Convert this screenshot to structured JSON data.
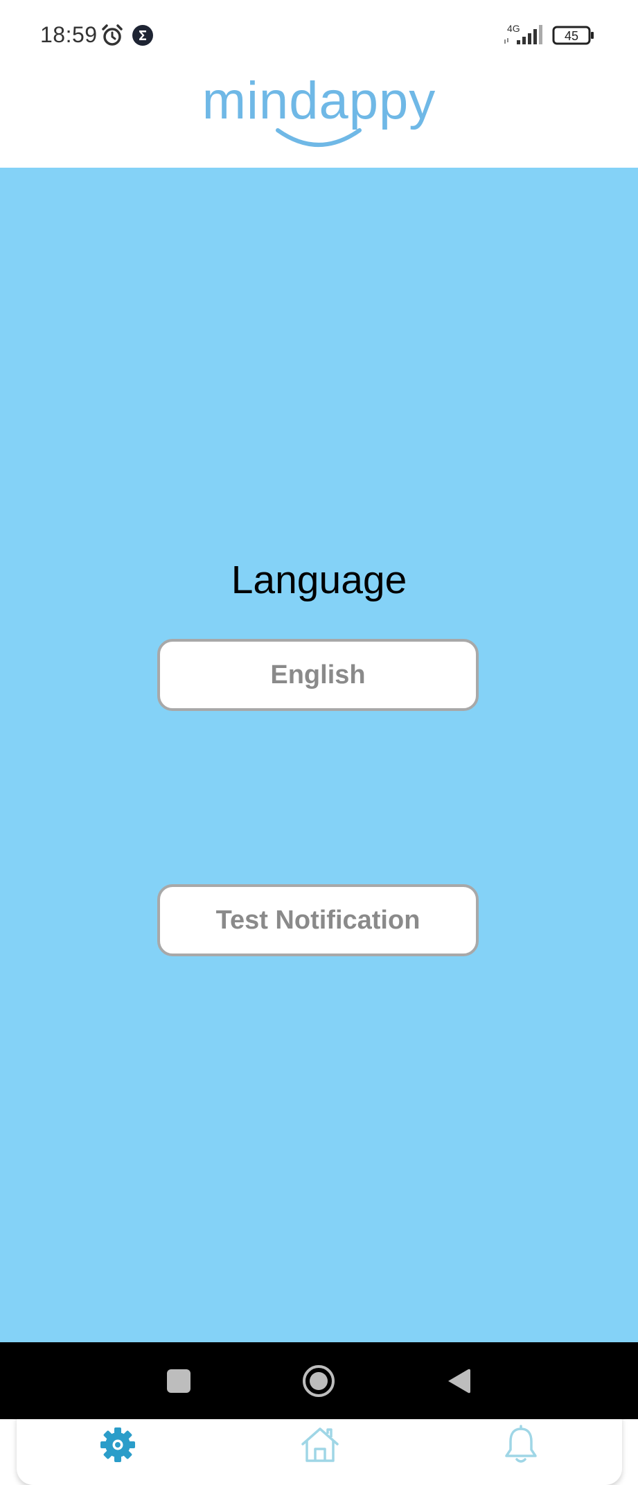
{
  "status_bar": {
    "time": "18:59",
    "network": "4G",
    "battery": "45"
  },
  "header": {
    "logo_text": "mindappy"
  },
  "main": {
    "section_title": "Language",
    "language_button": "English",
    "test_notification_button": "Test Notification"
  },
  "tab_bar": {
    "active_tab": "settings",
    "tabs": [
      {
        "id": "settings",
        "icon": "gear-icon"
      },
      {
        "id": "home",
        "icon": "home-icon"
      },
      {
        "id": "notifications",
        "icon": "bell-icon"
      }
    ],
    "active_color": "#2b9dc9",
    "inactive_color": "#9fd6e6"
  },
  "colors": {
    "background": "#84d2f7",
    "logo": "#6fb8e6",
    "button_border": "#a8a8a8",
    "button_text": "#8a8a8a"
  }
}
